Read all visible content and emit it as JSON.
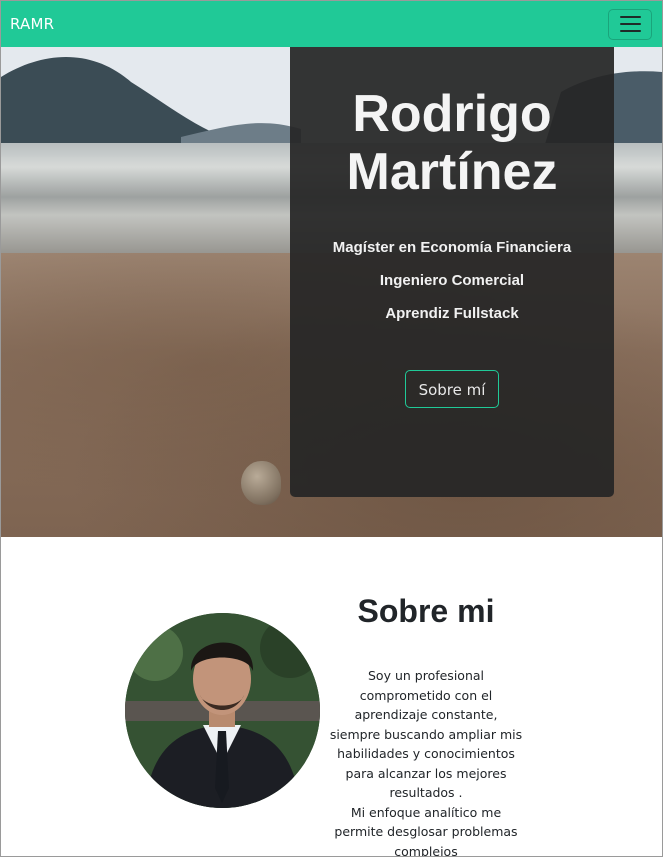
{
  "navbar": {
    "brand": "RAMR",
    "menu_icon": "hamburger-menu-icon"
  },
  "hero": {
    "name_line1": "Rodrigo",
    "name_line2": "Martínez",
    "subtitles": [
      "Magíster en Economía Financiera",
      "Ingeniero Comercial",
      "Aprendiz Fullstack"
    ],
    "button_label": "Sobre mí"
  },
  "about": {
    "title": "Sobre mi",
    "paragraph1": "Soy un profesional comprometido con el aprendizaje constante, siempre buscando ampliar mis habilidades y conocimientos para alcanzar los mejores resultados .",
    "paragraph2": "Mi enfoque analítico me permite desglosar problemas complejos"
  },
  "colors": {
    "accent": "#20c997",
    "hero_card": "#262626",
    "text_dark": "#212529"
  }
}
